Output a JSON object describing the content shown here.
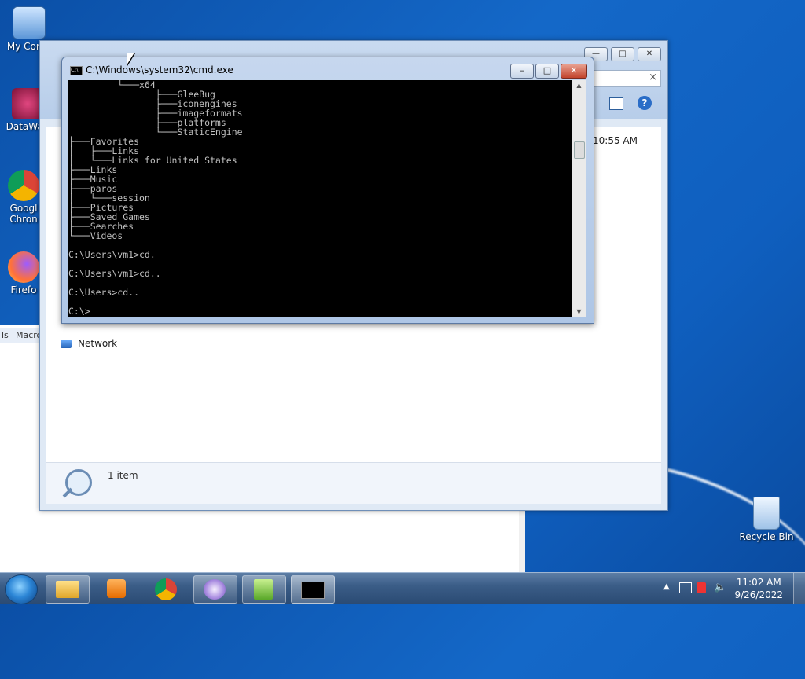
{
  "desktop": {
    "icons": [
      {
        "label": "My Comp",
        "color": "#6aa8e8"
      },
      {
        "label": "DataWag",
        "color": "#c0306a"
      },
      {
        "label": "Googl Chron",
        "color": "#34a853"
      },
      {
        "label": "Firefo",
        "color": "#ff7139"
      },
      {
        "label": "Recycle Bin",
        "color": "#cfe3f7"
      }
    ]
  },
  "explorer": {
    "time_text": "10:55 AM",
    "nav_network": "Network",
    "status_items": "1 item",
    "toolbar_left": [
      "ls",
      "Macro"
    ],
    "close_label": "×",
    "help_label": "?"
  },
  "cmd": {
    "title": "C:\\Windows\\system32\\cmd.exe",
    "lines": [
      "         └───x64",
      "                ├───GleeBug",
      "                ├───iconengines",
      "                ├───imageformats",
      "                ├───platforms",
      "                └───StaticEngine",
      "├───Favorites",
      "│   ├───Links",
      "│   └───Links for United States",
      "├───Links",
      "├───Music",
      "├───paros",
      "│   └───session",
      "├───Pictures",
      "├───Saved Games",
      "├───Searches",
      "└───Videos",
      "",
      "C:\\Users\\vm1>cd.",
      "",
      "C:\\Users\\vm1>cd..",
      "",
      "C:\\Users>cd..",
      "",
      "C:\\>"
    ],
    "btn_min": "‒",
    "btn_max": "□",
    "btn_close": "✕"
  },
  "taskbar": {
    "time": "11:02 AM",
    "date": "9/26/2022",
    "apps": [
      "file-explorer",
      "media-player",
      "chrome",
      "app-flower",
      "notepad-plus",
      "cmd"
    ]
  }
}
